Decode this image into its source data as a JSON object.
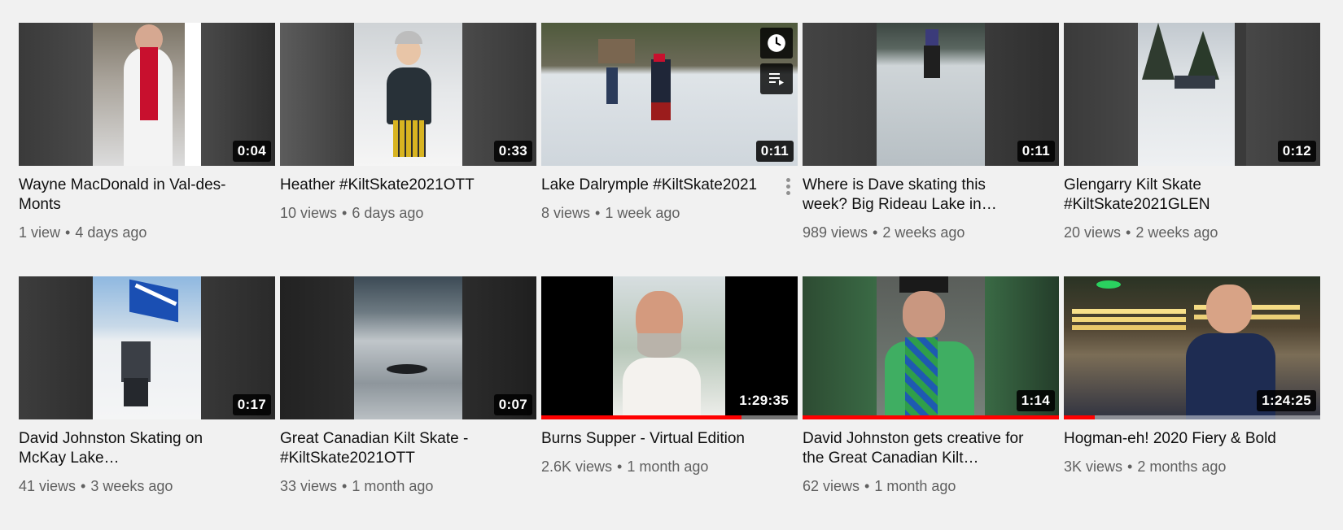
{
  "videos": [
    {
      "title": "Wayne MacDonald in Val-des-Monts",
      "views": "1 view",
      "age": "4 days ago",
      "duration": "0:04",
      "scene": "red-scarf"
    },
    {
      "title": "Heather #KiltSkate2021OTT",
      "views": "10 views",
      "age": "6 days ago",
      "duration": "0:33",
      "scene": "snow-woman"
    },
    {
      "title": "Lake Dalrymple #KiltSkate2021",
      "views": "8 views",
      "age": "1 week ago",
      "duration": "0:11",
      "scene": "rink",
      "hover": true
    },
    {
      "title": "Where is Dave skating this week? Big Rideau Lake in…",
      "views": "989 views",
      "age": "2 weeks ago",
      "duration": "0:11",
      "scene": "ice-far"
    },
    {
      "title": "Glengarry Kilt Skate #KiltSkate2021GLEN",
      "views": "20 views",
      "age": "2 weeks ago",
      "duration": "0:12",
      "scene": "trees"
    },
    {
      "title": "David Johnston Skating on McKay Lake…",
      "views": "41 views",
      "age": "3 weeks ago",
      "duration": "0:17",
      "scene": "flag"
    },
    {
      "title": "Great Canadian Kilt Skate - #KiltSkate2021OTT",
      "views": "33 views",
      "age": "1 month ago",
      "duration": "0:07",
      "scene": "dark-ice"
    },
    {
      "title": "Burns Supper - Virtual Edition",
      "views": "2.6K views",
      "age": "1 month ago",
      "duration": "1:29:35",
      "scene": "bald-man",
      "progress": 0.78
    },
    {
      "title": "David Johnston gets creative for the Great Canadian Kilt…",
      "views": "62 views",
      "age": "1 month ago",
      "duration": "1:14",
      "scene": "bagpipe",
      "progress": 1.0
    },
    {
      "title": "Hogman-eh! 2020 Fiery & Bold",
      "views": "3K views",
      "age": "2 months ago",
      "duration": "1:24:25",
      "scene": "presenter",
      "progress": 0.12
    }
  ],
  "hover_buttons": {
    "watch_later": "clock-icon",
    "add_to_queue": "queue-icon"
  }
}
